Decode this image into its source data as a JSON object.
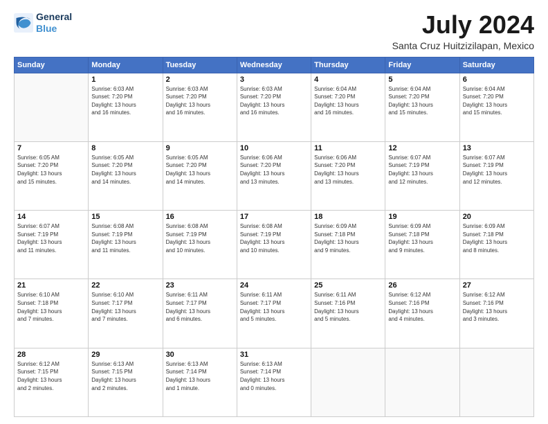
{
  "header": {
    "logo_line1": "General",
    "logo_line2": "Blue",
    "month": "July 2024",
    "location": "Santa Cruz Huitzizilapan, Mexico"
  },
  "days_of_week": [
    "Sunday",
    "Monday",
    "Tuesday",
    "Wednesday",
    "Thursday",
    "Friday",
    "Saturday"
  ],
  "weeks": [
    [
      {
        "day": "",
        "info": ""
      },
      {
        "day": "1",
        "info": "Sunrise: 6:03 AM\nSunset: 7:20 PM\nDaylight: 13 hours\nand 16 minutes."
      },
      {
        "day": "2",
        "info": "Sunrise: 6:03 AM\nSunset: 7:20 PM\nDaylight: 13 hours\nand 16 minutes."
      },
      {
        "day": "3",
        "info": "Sunrise: 6:03 AM\nSunset: 7:20 PM\nDaylight: 13 hours\nand 16 minutes."
      },
      {
        "day": "4",
        "info": "Sunrise: 6:04 AM\nSunset: 7:20 PM\nDaylight: 13 hours\nand 16 minutes."
      },
      {
        "day": "5",
        "info": "Sunrise: 6:04 AM\nSunset: 7:20 PM\nDaylight: 13 hours\nand 15 minutes."
      },
      {
        "day": "6",
        "info": "Sunrise: 6:04 AM\nSunset: 7:20 PM\nDaylight: 13 hours\nand 15 minutes."
      }
    ],
    [
      {
        "day": "7",
        "info": "Sunrise: 6:05 AM\nSunset: 7:20 PM\nDaylight: 13 hours\nand 15 minutes."
      },
      {
        "day": "8",
        "info": "Sunrise: 6:05 AM\nSunset: 7:20 PM\nDaylight: 13 hours\nand 14 minutes."
      },
      {
        "day": "9",
        "info": "Sunrise: 6:05 AM\nSunset: 7:20 PM\nDaylight: 13 hours\nand 14 minutes."
      },
      {
        "day": "10",
        "info": "Sunrise: 6:06 AM\nSunset: 7:20 PM\nDaylight: 13 hours\nand 13 minutes."
      },
      {
        "day": "11",
        "info": "Sunrise: 6:06 AM\nSunset: 7:20 PM\nDaylight: 13 hours\nand 13 minutes."
      },
      {
        "day": "12",
        "info": "Sunrise: 6:07 AM\nSunset: 7:19 PM\nDaylight: 13 hours\nand 12 minutes."
      },
      {
        "day": "13",
        "info": "Sunrise: 6:07 AM\nSunset: 7:19 PM\nDaylight: 13 hours\nand 12 minutes."
      }
    ],
    [
      {
        "day": "14",
        "info": "Sunrise: 6:07 AM\nSunset: 7:19 PM\nDaylight: 13 hours\nand 11 minutes."
      },
      {
        "day": "15",
        "info": "Sunrise: 6:08 AM\nSunset: 7:19 PM\nDaylight: 13 hours\nand 11 minutes."
      },
      {
        "day": "16",
        "info": "Sunrise: 6:08 AM\nSunset: 7:19 PM\nDaylight: 13 hours\nand 10 minutes."
      },
      {
        "day": "17",
        "info": "Sunrise: 6:08 AM\nSunset: 7:19 PM\nDaylight: 13 hours\nand 10 minutes."
      },
      {
        "day": "18",
        "info": "Sunrise: 6:09 AM\nSunset: 7:18 PM\nDaylight: 13 hours\nand 9 minutes."
      },
      {
        "day": "19",
        "info": "Sunrise: 6:09 AM\nSunset: 7:18 PM\nDaylight: 13 hours\nand 9 minutes."
      },
      {
        "day": "20",
        "info": "Sunrise: 6:09 AM\nSunset: 7:18 PM\nDaylight: 13 hours\nand 8 minutes."
      }
    ],
    [
      {
        "day": "21",
        "info": "Sunrise: 6:10 AM\nSunset: 7:18 PM\nDaylight: 13 hours\nand 7 minutes."
      },
      {
        "day": "22",
        "info": "Sunrise: 6:10 AM\nSunset: 7:17 PM\nDaylight: 13 hours\nand 7 minutes."
      },
      {
        "day": "23",
        "info": "Sunrise: 6:11 AM\nSunset: 7:17 PM\nDaylight: 13 hours\nand 6 minutes."
      },
      {
        "day": "24",
        "info": "Sunrise: 6:11 AM\nSunset: 7:17 PM\nDaylight: 13 hours\nand 5 minutes."
      },
      {
        "day": "25",
        "info": "Sunrise: 6:11 AM\nSunset: 7:16 PM\nDaylight: 13 hours\nand 5 minutes."
      },
      {
        "day": "26",
        "info": "Sunrise: 6:12 AM\nSunset: 7:16 PM\nDaylight: 13 hours\nand 4 minutes."
      },
      {
        "day": "27",
        "info": "Sunrise: 6:12 AM\nSunset: 7:16 PM\nDaylight: 13 hours\nand 3 minutes."
      }
    ],
    [
      {
        "day": "28",
        "info": "Sunrise: 6:12 AM\nSunset: 7:15 PM\nDaylight: 13 hours\nand 2 minutes."
      },
      {
        "day": "29",
        "info": "Sunrise: 6:13 AM\nSunset: 7:15 PM\nDaylight: 13 hours\nand 2 minutes."
      },
      {
        "day": "30",
        "info": "Sunrise: 6:13 AM\nSunset: 7:14 PM\nDaylight: 13 hours\nand 1 minute."
      },
      {
        "day": "31",
        "info": "Sunrise: 6:13 AM\nSunset: 7:14 PM\nDaylight: 13 hours\nand 0 minutes."
      },
      {
        "day": "",
        "info": ""
      },
      {
        "day": "",
        "info": ""
      },
      {
        "day": "",
        "info": ""
      }
    ]
  ]
}
